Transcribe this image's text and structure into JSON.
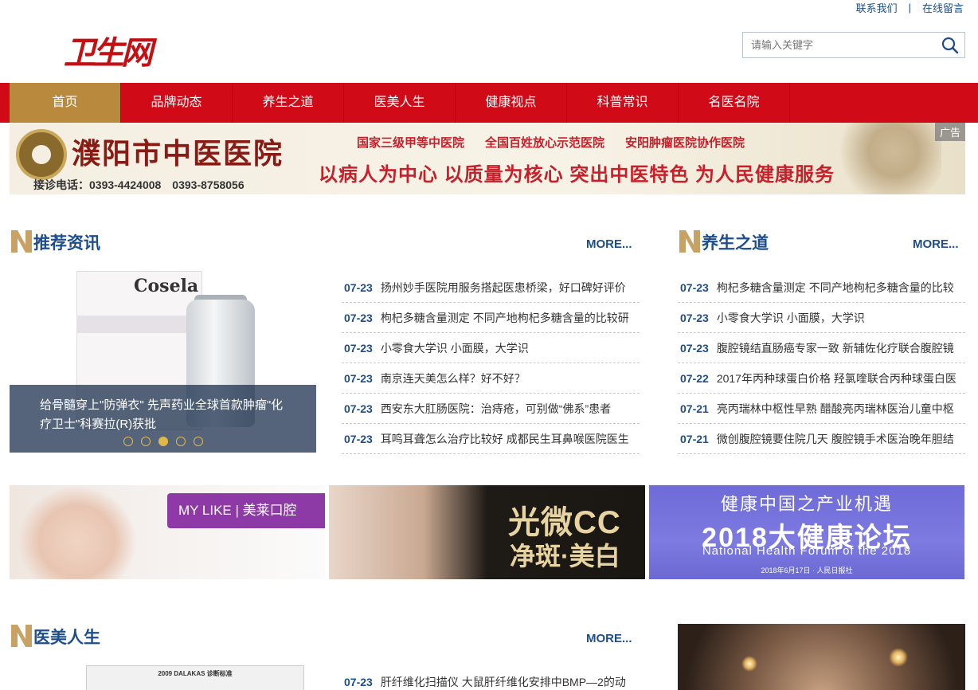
{
  "top_links": {
    "contact": "联系我们",
    "separator": "|",
    "message": "在线留言"
  },
  "logo": {
    "text": "卫生网"
  },
  "search": {
    "placeholder": "请输入关键字",
    "icon": "search-icon"
  },
  "nav": {
    "items": [
      {
        "label": "首页",
        "active": true
      },
      {
        "label": "品牌动态"
      },
      {
        "label": "养生之道"
      },
      {
        "label": "医美人生"
      },
      {
        "label": "健康视点"
      },
      {
        "label": "科普常识"
      },
      {
        "label": "名医名院"
      }
    ]
  },
  "banner": {
    "hospital_name": "濮阳市中医医院",
    "tags": [
      "国家三级甲等中医院",
      "全国百姓放心示范医院",
      "安阳肿瘤医院协作医院"
    ],
    "slogan": "以病人为中心 以质量为核心 突出中医特色 为人民健康服务",
    "phone": "接诊电话：0393-4424008　0393-8758056",
    "ad_label": "广告"
  },
  "recommend": {
    "title": "推荐资讯",
    "more": "MORE...",
    "slider": {
      "product_brand": "Cosela",
      "caption": "给骨髓穿上\"防弹衣\" 先声药业全球首款肿瘤\"化疗卫士\"科赛拉(R)获批",
      "dot_count": 5,
      "active_dot": 3
    },
    "items": [
      {
        "date": "07-23",
        "title": "扬州妙手医院用服务搭起医患桥梁，好口碑好评价"
      },
      {
        "date": "07-23",
        "title": "枸杞多糖含量测定 不同产地枸杞多糖含量的比较研"
      },
      {
        "date": "07-23",
        "title": "小零食大学识 小面膜，大学识"
      },
      {
        "date": "07-23",
        "title": "南京连天美怎么样？好不好？"
      },
      {
        "date": "07-23",
        "title": "西安东大肛肠医院：治痔疮，可别做“佛系”患者"
      },
      {
        "date": "07-23",
        "title": "耳鸣耳聋怎么治疗比较好 成都民生耳鼻喉医院医生"
      }
    ]
  },
  "health": {
    "title": "养生之道",
    "more": "MORE...",
    "items": [
      {
        "date": "07-23",
        "title": "枸杞多糖含量测定 不同产地枸杞多糖含量的比较"
      },
      {
        "date": "07-23",
        "title": "小零食大学识 小面膜，大学识"
      },
      {
        "date": "07-23",
        "title": "腹腔镜结直肠癌专家一致 新辅佐化疗联合腹腔镜"
      },
      {
        "date": "07-22",
        "title": "2017年丙种球蛋白价格 羟氯喹联合丙种球蛋白医"
      },
      {
        "date": "07-21",
        "title": "亮丙瑞林中枢性早熟 醋酸亮丙瑞林医治儿童中枢"
      },
      {
        "date": "07-21",
        "title": "微创腹腔镜要住院几天 腹腔镜手术医治晚年胆结"
      }
    ]
  },
  "ads": {
    "mylike": "MY LIKE | 美莱口腔",
    "cc_line1": "光微CC",
    "cc_line2": "净斑·美白",
    "forum_line1": "健康中国之产业机遇",
    "forum_line2": "2018大健康论坛",
    "forum_line3": "National Health Forum of the 2018",
    "forum_line4": "2018年6月17日 · 人民日报社"
  },
  "beauty": {
    "title": "医美人生",
    "more": "MORE...",
    "doc_thumb_title": "2009 DALAKAS 诊断标准",
    "items": [
      {
        "date": "07-23",
        "title": "肝纤维化扫描仪 大鼠肝纤维化安排中BMP—2的动"
      }
    ]
  },
  "colors": {
    "brand_red": "#d00a17",
    "nav_active": "#b98a3e",
    "link_blue": "#1e4d8c"
  }
}
